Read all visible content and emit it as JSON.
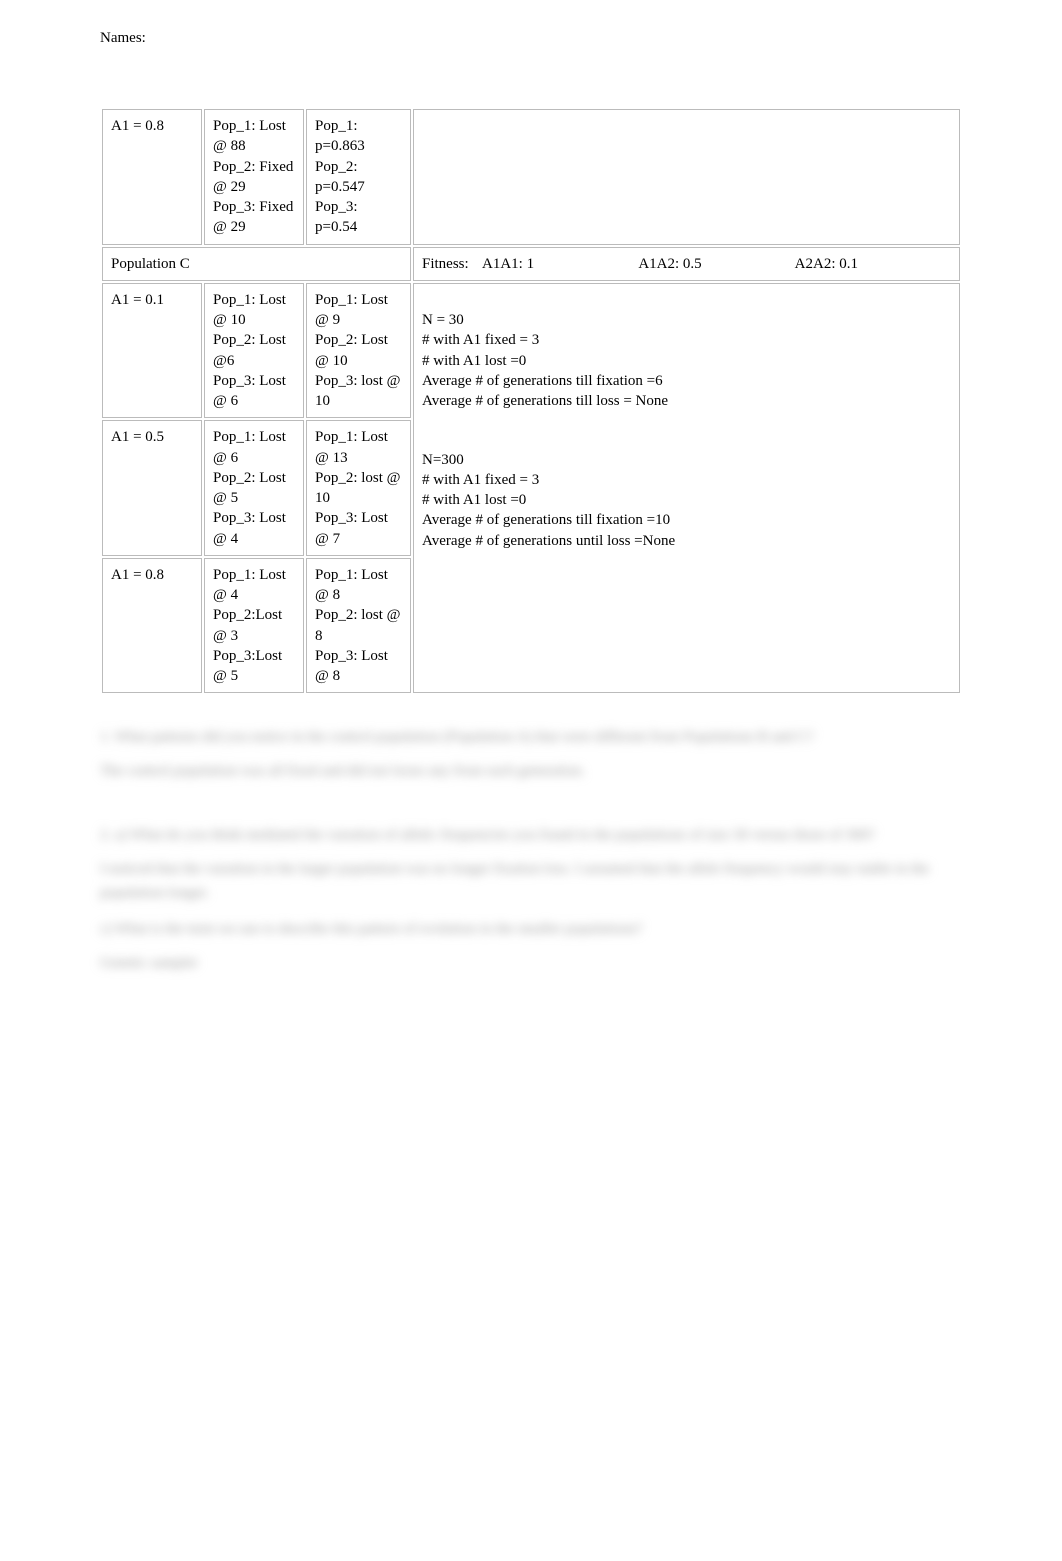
{
  "header": {
    "names_label": "Names:"
  },
  "table": {
    "row1": {
      "c1": "A1 = 0.8",
      "c2": "Pop_1: Lost @ 88\nPop_2: Fixed @ 29\nPop_3: Fixed @ 29",
      "c3": "Pop_1: p=0.863\nPop_2: p=0.547\nPop_3: p=0.54",
      "c4": ""
    },
    "row2": {
      "c1": "Population C",
      "fitness_label": "Fitness:",
      "a1a1": "A1A1: 1",
      "a1a2": "A1A2: 0.5",
      "a2a2": "A2A2: 0.1"
    },
    "row3": {
      "c1": "A1 = 0.1",
      "c2": "Pop_1: Lost @ 10\nPop_2: Lost @6\nPop_3: Lost @ 6",
      "c3": "Pop_1: Lost @ 9\nPop_2: Lost @ 10\nPop_3: lost @ 10",
      "c4": " N = 30\n# with A1 fixed = 3\n# with A1 lost =0\nAverage # of generations till fixation =6\nAverage # of generations till loss = None"
    },
    "row4": {
      "c1": "A1 = 0.5",
      "c2": "Pop_1: Lost @ 6\nPop_2: Lost @ 5\nPop_3: Lost @ 4",
      "c3": "Pop_1: Lost @ 13\nPop_2: lost @ 10\nPop_3: Lost @ 7",
      "c4": "N=300\n# with A1 fixed = 3\n# with A1 lost =0\nAverage # of generations till fixation =10\nAverage # of generations until loss =None"
    },
    "row5": {
      "c1": "A1 = 0.8",
      "c2": "Pop_1: Lost @ 4\nPop_2:Lost @ 3\nPop_3:Lost @ 5",
      "c3": "Pop_1: Lost @ 8\nPop_2: lost @ 8\nPop_3: Lost @ 8",
      "c4": ""
    }
  },
  "q1": {
    "text": "1.   What patterns did you notice in the control population (Population A) that were different from Populations B and C?",
    "answer": "The control population was all fixed and did not loose any from each generation."
  },
  "q2": {
    "text": "2.   a) What do you think mediated the variation of allelic frequencies you found in the populations of size 30 versus those of 300?",
    "answer_a": "I noticed that the variation in the larger population was no longer fixation loss. I assumed that the allele frequency would stay stable in the population longer.",
    "text_b": "c) What is the term we use to describe this pattern of evolution in the smaller populations?",
    "answer_b": "Genetic sampler"
  }
}
